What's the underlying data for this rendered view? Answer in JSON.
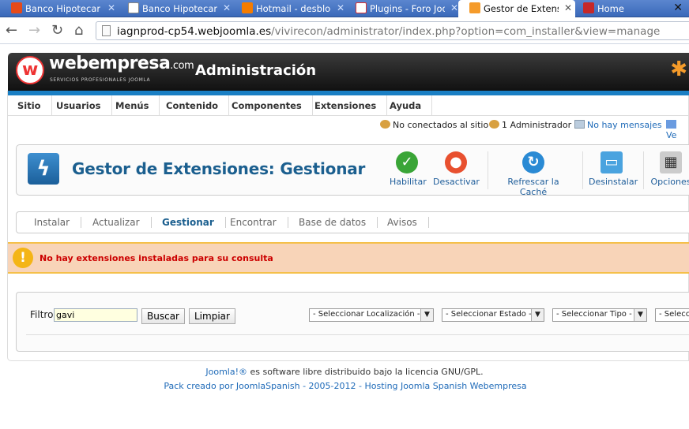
{
  "tabs": [
    {
      "label": "Banco Hipotecario",
      "icon_color": "#e64a19"
    },
    {
      "label": "Banco Hipotecario",
      "icon_color": "#ffffff"
    },
    {
      "label": "Hotmail - desbloq",
      "icon_color": "#f57c00"
    },
    {
      "label": "Plugins - Foro Joom",
      "icon_color": "#ffffff"
    },
    {
      "label": "Gestor de Extensio",
      "icon_color": "#f59b2a"
    },
    {
      "label": "Home",
      "icon_color": "#c62828"
    }
  ],
  "url": {
    "host": "iagnprod-cp54.webjoomla.es",
    "path": "/vivirecon/administrator/index.php?option=com_installer&view=manage"
  },
  "header": {
    "logo_text": "webempresa",
    "logo_suffix": ".com",
    "logo_sub": "SERVICIOS PROFESIONALES JOOMLA",
    "title": "Administración"
  },
  "menu": [
    "Sitio",
    "Usuarios",
    "Menús",
    "Contenido",
    "Componentes",
    "Extensiones",
    "Ayuda"
  ],
  "status": {
    "offline": "No conectados al sitio",
    "admins": "1 Administrador",
    "messages": "No hay mensajes",
    "view": "Ve"
  },
  "toolbar": {
    "title": "Gestor de Extensiones: Gestionar",
    "enable": "Habilitar",
    "disable": "Desactivar",
    "refresh": "Refrescar la Caché",
    "uninstall": "Desinstalar",
    "options": "Opciones"
  },
  "subtabs": [
    "Instalar",
    "Actualizar",
    "Gestionar",
    "Encontrar",
    "Base de datos",
    "Avisos"
  ],
  "active_subtab": "Gestionar",
  "warning": "No hay extensiones instaladas para su consulta",
  "filter": {
    "label": "Filtro:",
    "value": "gavi",
    "search": "Buscar",
    "clear": "Limpiar",
    "location": "- Seleccionar Localización -",
    "state": "- Seleccionar Estado -",
    "type": "- Seleccionar Tipo -",
    "more": "- Selecc"
  },
  "footer": {
    "line1_link": "Joomla!®",
    "line1_text": " es software libre distribuido bajo la licencia GNU/GPL.",
    "line2": "Pack creado por JoomlaSpanish - 2005-2012 - Hosting Joomla Spanish Webempresa"
  },
  "colors": {
    "accent": "#1b5f8f",
    "warn_bg": "#f8d4b8",
    "warn_text": "#cc0000"
  }
}
